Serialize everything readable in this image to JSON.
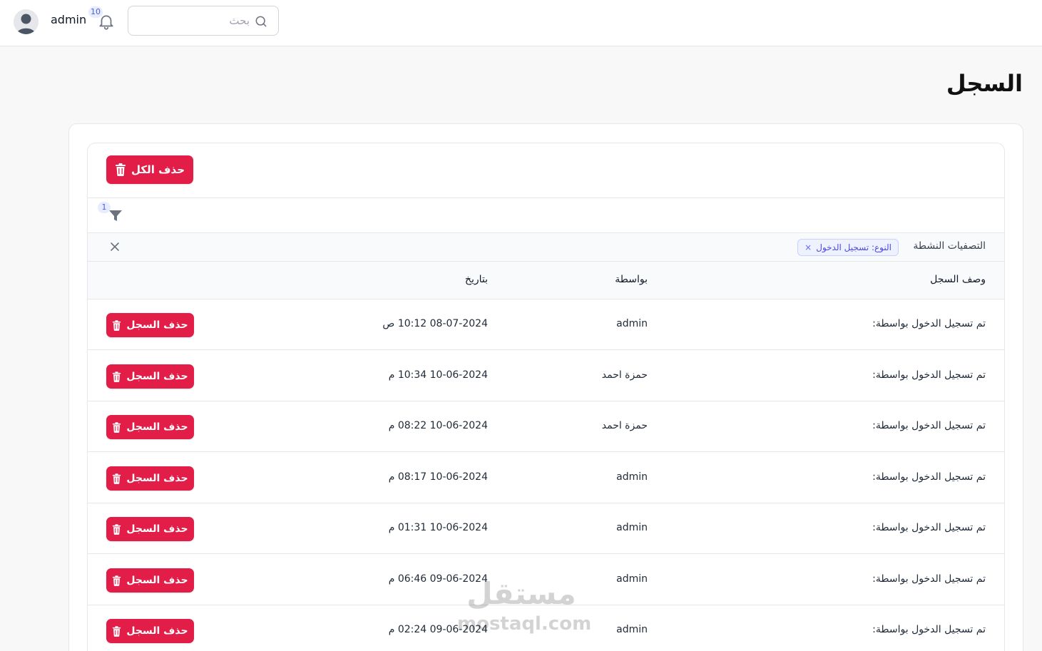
{
  "header": {
    "username": "admin",
    "notifications_count": "10",
    "search_placeholder": "بحث"
  },
  "page": {
    "title": "السجل"
  },
  "toolbar": {
    "delete_all_label": "حذف الكل"
  },
  "filters": {
    "count": "1",
    "active_label": "التصفيات النشطة",
    "chip_label": "النوع: تسجيل الدخول",
    "chip_remove": "×"
  },
  "table": {
    "headers": {
      "description": "وصف السجل",
      "by": "بواسطة",
      "date": "بتاريخ"
    },
    "delete_label": "حذف السجل",
    "rows": [
      {
        "description": "تم تسجيل الدخول بواسطة:",
        "by": "admin",
        "date": "08-07-2024 10:12 ص"
      },
      {
        "description": "تم تسجيل الدخول بواسطة:",
        "by": "حمزة احمد",
        "date": "10-06-2024 10:34 م"
      },
      {
        "description": "تم تسجيل الدخول بواسطة:",
        "by": "حمزة احمد",
        "date": "10-06-2024 08:22 م"
      },
      {
        "description": "تم تسجيل الدخول بواسطة:",
        "by": "admin",
        "date": "10-06-2024 08:17 م"
      },
      {
        "description": "تم تسجيل الدخول بواسطة:",
        "by": "admin",
        "date": "10-06-2024 01:31 م"
      },
      {
        "description": "تم تسجيل الدخول بواسطة:",
        "by": "admin",
        "date": "09-06-2024 06:46 م"
      },
      {
        "description": "تم تسجيل الدخول بواسطة:",
        "by": "admin",
        "date": "09-06-2024 02:24 م"
      }
    ]
  },
  "watermark": {
    "arabic": "مستقل",
    "latin": "mostaql.com"
  },
  "colors": {
    "danger": "#e11d48",
    "chip_bg": "#eef2ff",
    "chip_text": "#4f46e5",
    "badge_bg": "#e8ecff"
  }
}
